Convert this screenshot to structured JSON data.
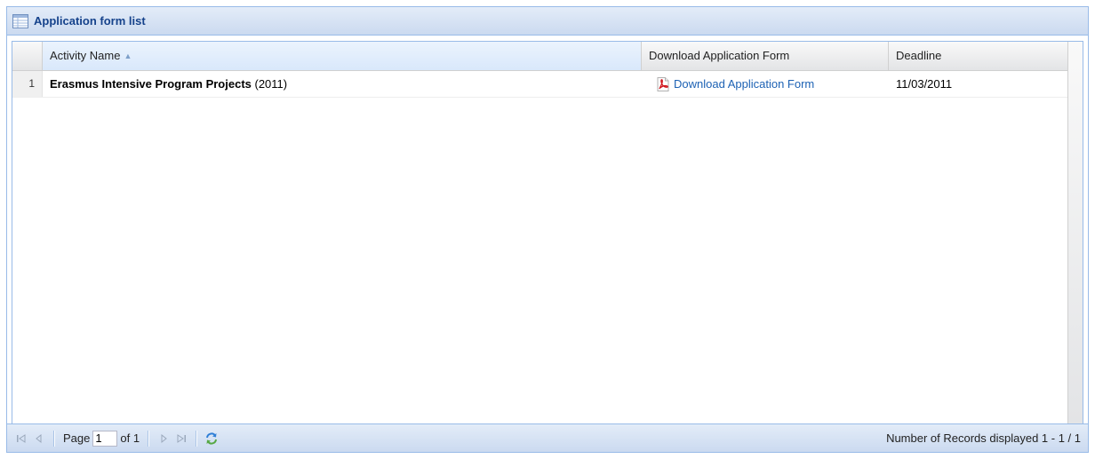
{
  "panel": {
    "title": "Application form list"
  },
  "grid": {
    "columns": [
      {
        "label": "Activity Name",
        "sorted": "asc"
      },
      {
        "label": "Download Application Form"
      },
      {
        "label": "Deadline"
      }
    ],
    "rows": [
      {
        "number": "1",
        "activity_name": "Erasmus Intensive Program Projects",
        "activity_year": "(2011)",
        "download_label": "Download Application Form",
        "deadline": "11/03/2011"
      }
    ]
  },
  "pager": {
    "page_label": "Page",
    "page_value": "1",
    "of_label": "of 1",
    "records_text": "Number of Records displayed 1 - 1 / 1"
  },
  "colors": {
    "header_title": "#15428b",
    "link": "#1d62b4",
    "border": "#99bbe8"
  },
  "icons": [
    "grid-icon",
    "sort-asc-icon",
    "pdf-icon",
    "first-page-icon",
    "prev-page-icon",
    "next-page-icon",
    "last-page-icon",
    "refresh-icon"
  ]
}
